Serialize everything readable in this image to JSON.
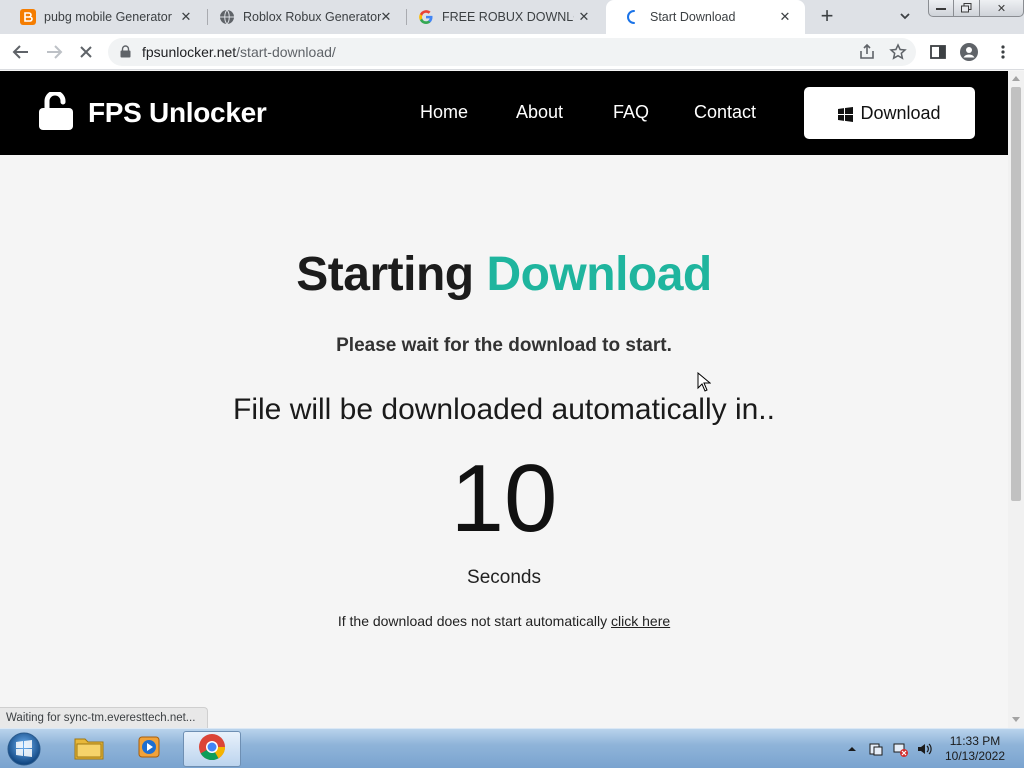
{
  "browser": {
    "tabs": [
      {
        "title": "pubg mobile Generator",
        "icon": "blogger-icon",
        "active": false
      },
      {
        "title": "Roblox Robux Generator",
        "icon": "globe-icon",
        "active": false
      },
      {
        "title": "FREE ROBUX DOWNLOAD",
        "icon": "google-icon",
        "active": false
      },
      {
        "title": "Start Download",
        "icon": "loading-spinner-icon",
        "active": true
      }
    ],
    "url_host": "fpsunlocker.net",
    "url_path": "/start-download/",
    "status_text": "Waiting for sync-tm.everesttech.net..."
  },
  "site": {
    "logo_text": "FPS Unlocker",
    "nav": [
      "Home",
      "About",
      "FAQ",
      "Contact"
    ],
    "download_button": "Download",
    "accent_color": "#1fb59e"
  },
  "main": {
    "heading_plain": "Starting",
    "heading_accent": "Download",
    "subtitle": "Please wait for the download to start.",
    "auto_text": "File will be downloaded automatically in..",
    "countdown": "10",
    "unit": "Seconds",
    "fallback_text": "If the download does not start automatically",
    "fallback_link": "click here"
  },
  "taskbar": {
    "time": "11:33 PM",
    "date": "10/13/2022"
  }
}
